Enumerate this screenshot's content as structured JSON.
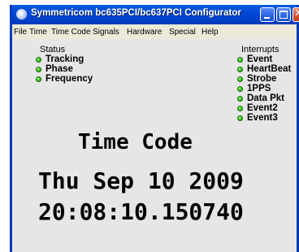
{
  "window": {
    "title": "Symmetricom bc635PCI/bc637PCI Configurator"
  },
  "menu": [
    "File",
    "Time",
    "Time Code",
    "Signals",
    "Hardware",
    "Special",
    "Help"
  ],
  "status": {
    "title": "Status",
    "items": [
      "Tracking",
      "Phase",
      "Frequency"
    ]
  },
  "interrupts": {
    "title": "Interrupts",
    "items": [
      "Event",
      "HeartBeat",
      "Strobe",
      "1PPS",
      "Data Pkt",
      "Event2",
      "Event3"
    ]
  },
  "display": {
    "heading": "Time Code",
    "date": "Thu Sep 10 2009",
    "time": "20:08:10.150740"
  },
  "colors": {
    "led": "#3DD11C",
    "titlebar": "#0047D6",
    "panel": "#E6E6E6"
  }
}
